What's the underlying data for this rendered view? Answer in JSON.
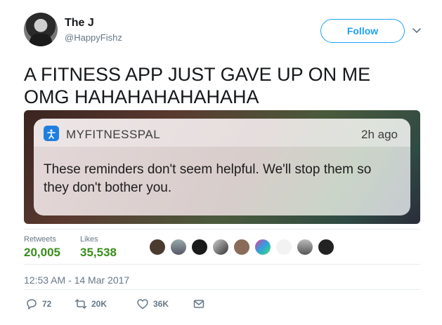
{
  "user": {
    "name": "The J",
    "handle": "@HappyFishz"
  },
  "follow_label": "Follow",
  "tweet_text_line1": "A FITNESS APP JUST GAVE UP ON ME",
  "tweet_text_line2": "OMG HAHAHAHAHAHAHA",
  "notification": {
    "app_name": "MYFITNESSPAL",
    "time_ago": "2h ago",
    "body": "These reminders don't seem helpful. We'll stop them so they don't bother you."
  },
  "stats": {
    "retweets_label": "Retweets",
    "retweets_value": "20,005",
    "likes_label": "Likes",
    "likes_value": "35,538"
  },
  "timestamp": "12:53 AM - 14 Mar 2017",
  "actions": {
    "replies": "72",
    "retweets": "20K",
    "likes": "36K"
  },
  "colors": {
    "accent": "#1da1f2",
    "stat_green": "#3a8c1c",
    "muted": "#657786"
  },
  "icons": [
    "reply-icon",
    "retweet-icon",
    "like-icon",
    "message-icon",
    "chevron-down-icon",
    "myfitnesspal-app-icon"
  ]
}
